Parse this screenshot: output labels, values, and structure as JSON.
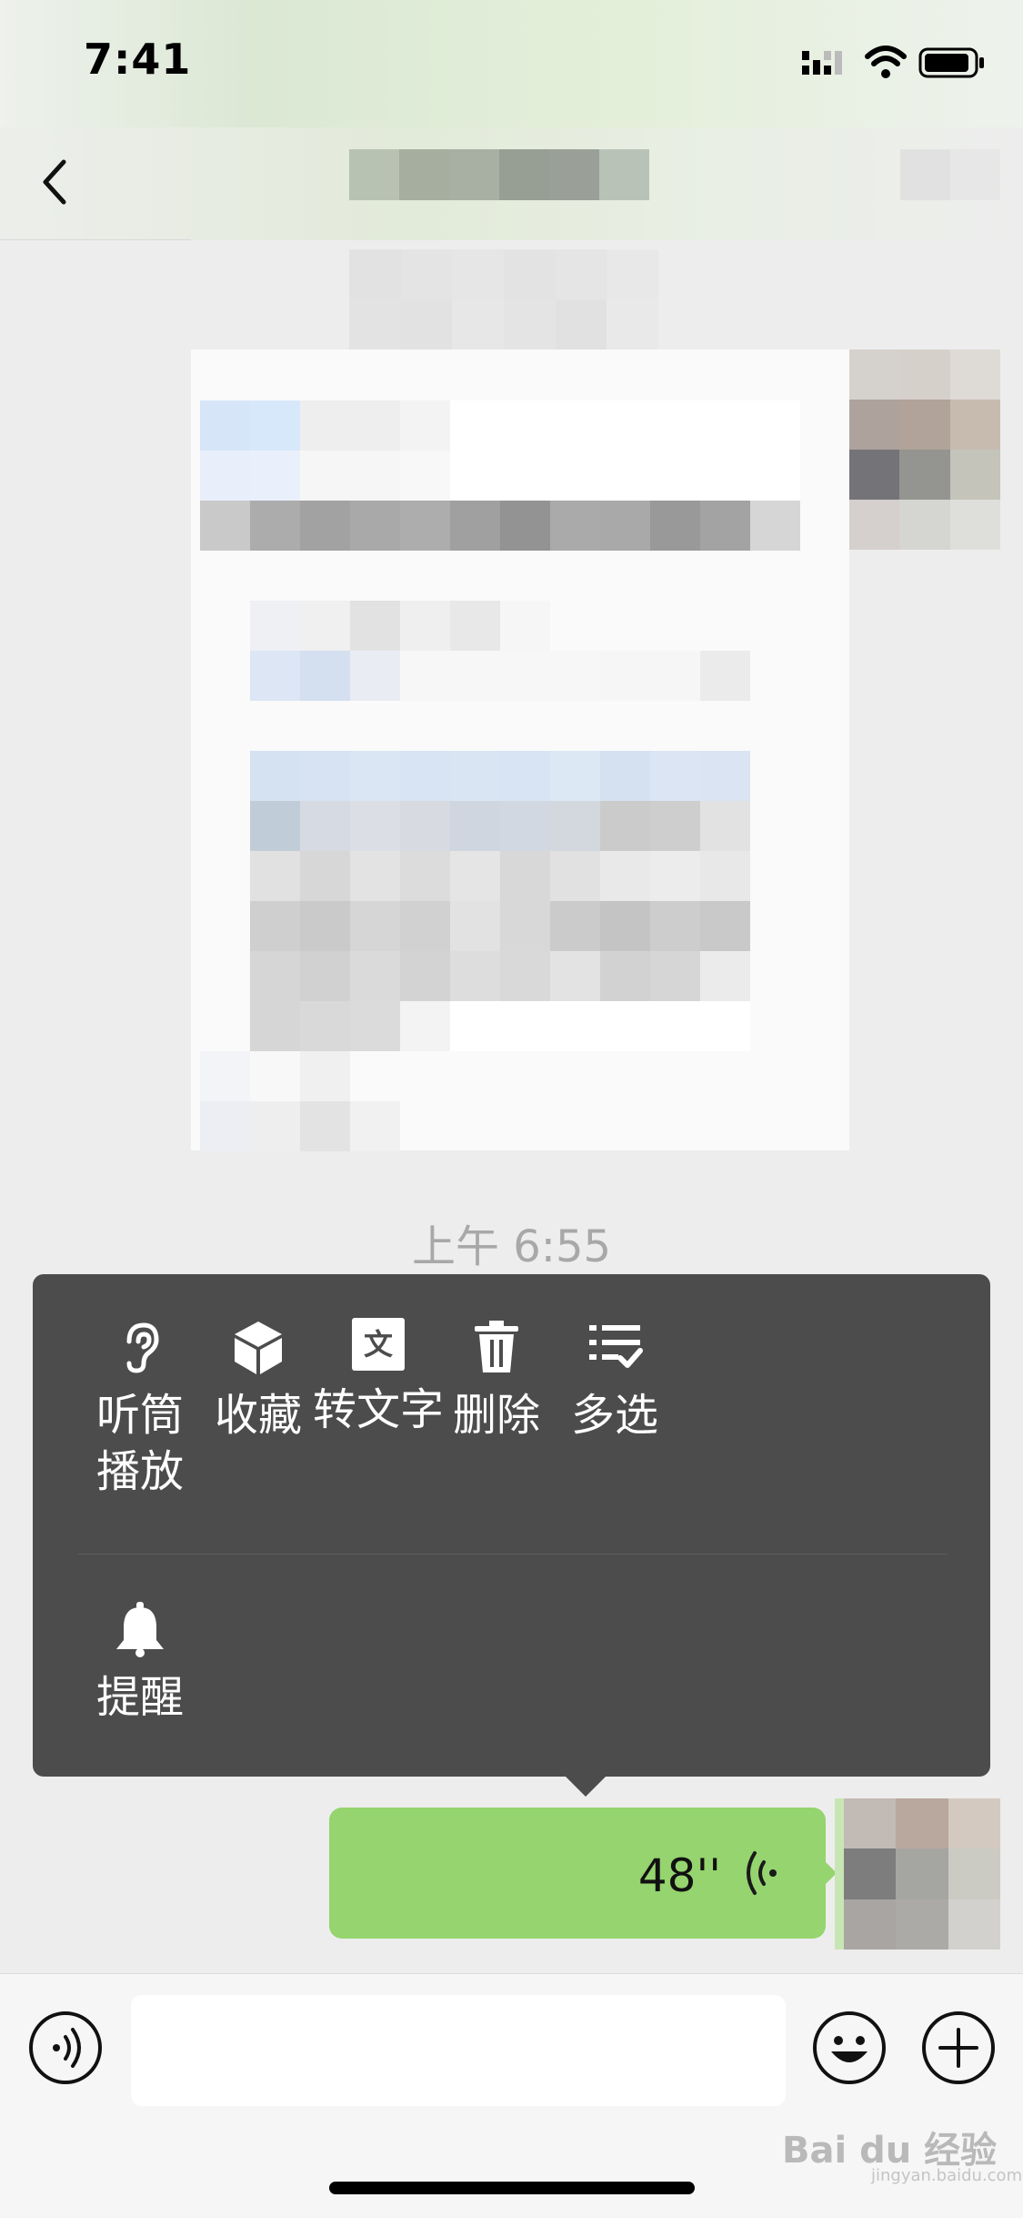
{
  "status_bar": {
    "time": "7:41"
  },
  "header": {
    "title": ""
  },
  "chat": {
    "timestamp": "上午 6:55",
    "voice_message": {
      "duration": "48''"
    }
  },
  "context_menu": {
    "items": [
      {
        "icon": "ear-icon",
        "label": "听筒\n播放"
      },
      {
        "icon": "cube-icon",
        "label": "收藏"
      },
      {
        "icon": "text-convert-icon",
        "label": "转文字",
        "glyph": "文"
      },
      {
        "icon": "trash-icon",
        "label": "删除"
      },
      {
        "icon": "multi-select-icon",
        "label": "多选"
      },
      {
        "icon": "bell-icon",
        "label": "提醒"
      }
    ]
  },
  "input_bar": {
    "value": ""
  },
  "watermark": {
    "brand": "Bai du 经验",
    "url": "jingyan.baidu.com"
  },
  "colors": {
    "bubble": "#95d46e",
    "menu": "#4c4c4c",
    "background": "#ededed"
  }
}
